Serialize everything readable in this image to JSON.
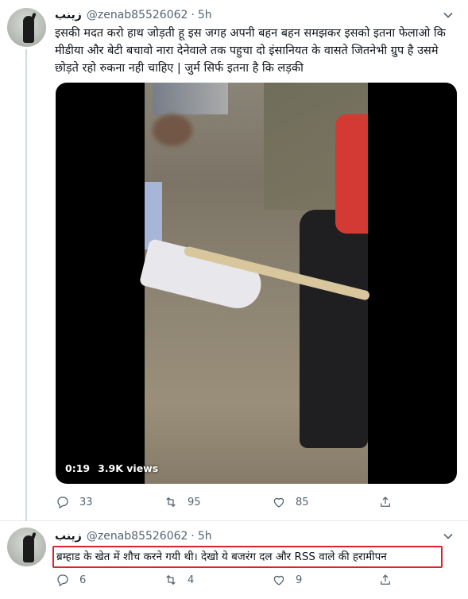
{
  "tweets": [
    {
      "author_name": "زینب",
      "handle": "@zenab85526062",
      "time": "5h",
      "text": "इसकी मदत करो हाथ जोड़ती  हू  इस जगह अपनी बहन बहन समझकर इसको इतना फेलाओ कि मीडीया और बेटी बचावो नारा देनेवाले तक पहुचा दो इंसानियत के वासते जितनेभी ग्रुप है उसमे  छोड़ते रहो रुकना नही चाहिए | जुर्म सिर्फ इतना है कि लड़की",
      "video": {
        "duration": "0:19",
        "views": "3.9K views"
      },
      "replies": "33",
      "retweets": "95",
      "likes": "85"
    },
    {
      "author_name": "زینب",
      "handle": "@zenab85526062",
      "time": "5h",
      "text": "ब्रम्हाड के खेत में शौच करने गयी थी। देखो ये बजरंग दल और RSS वाले की हरामीपन",
      "replies": "6",
      "retweets": "4",
      "likes": "9"
    }
  ],
  "icons": {
    "reply": "reply-icon",
    "retweet": "retweet-icon",
    "like": "heart-icon",
    "share": "share-icon",
    "more": "chevron-down-icon"
  },
  "colors": {
    "text": "#0f1419",
    "secondary": "#536471",
    "highlight_border": "#e0202a"
  }
}
